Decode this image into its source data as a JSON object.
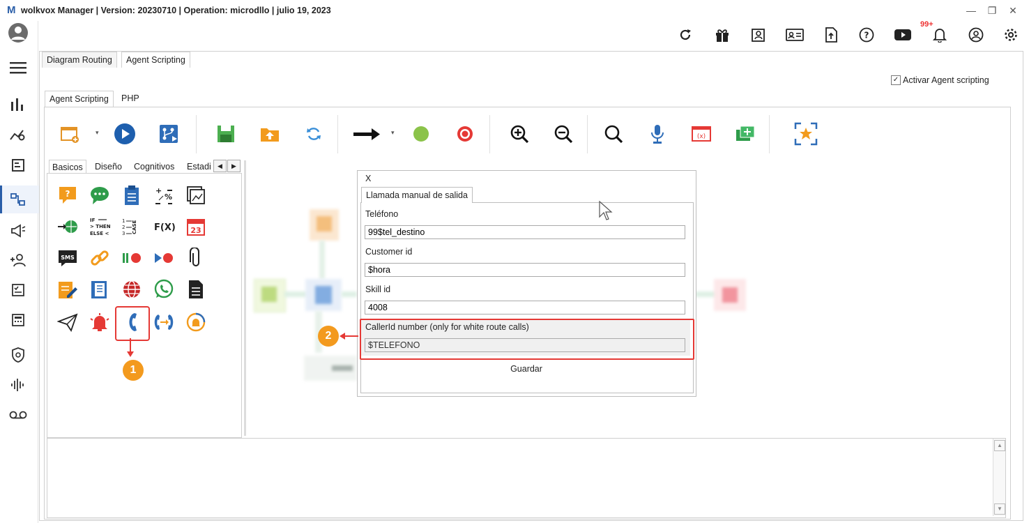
{
  "window": {
    "title": "wolkvox Manager  | Version: 20230710  |  Operation: microdllo | julio 19, 2023",
    "logo": "M",
    "minimize": "—",
    "restore": "❐",
    "close": "✕"
  },
  "header": {
    "notification_badge": "99+",
    "icons": [
      "refresh-icon",
      "gift-icon",
      "contacts-book-icon",
      "id-card-icon",
      "upload-file-icon",
      "help-icon",
      "youtube-icon",
      "bell-icon",
      "user-circle-icon",
      "settings-icon"
    ]
  },
  "sidebar": {
    "icons": [
      "menu-icon",
      "bar-chart-icon",
      "analytics-icon",
      "report-icon",
      "routing-icon",
      "campaign-icon",
      "users-icon",
      "checklist-icon",
      "calculator-icon",
      "security-icon",
      "voice-icon",
      "voicemail-icon"
    ]
  },
  "main": {
    "tabs": [
      "Diagram Routing",
      "Agent Scripting"
    ],
    "activate_label": "Activar Agent scripting",
    "activate_checked": true,
    "subtabs": [
      "Agent Scripting",
      "PHP"
    ]
  },
  "palette": {
    "tabs": [
      "Basicos",
      "Diseño",
      "Cognitivos",
      "Estadi"
    ]
  },
  "dialog": {
    "close": "X",
    "tab": "Llamada manual de salida",
    "fields": [
      {
        "label": "Teléfono",
        "value": "99$tel_destino"
      },
      {
        "label": "Customer id",
        "value": "$hora"
      },
      {
        "label": "Skill id",
        "value": "4008"
      },
      {
        "label": "CallerId number  (only for white route calls)",
        "value": "$TELEFONO"
      }
    ],
    "save": "Guardar"
  },
  "annotations": {
    "marker1": "1",
    "marker2": "2"
  },
  "colors": {
    "accent_red": "#e53935",
    "marker_orange": "#f39a1e",
    "brand_blue": "#2a5ea8"
  }
}
